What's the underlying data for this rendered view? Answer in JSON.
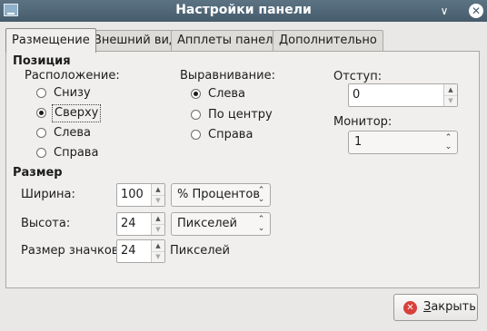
{
  "window": {
    "title": "Настройки панели",
    "app_icon": "panel-icon",
    "buttons": [
      "chevron-down-icon",
      "close-icon"
    ]
  },
  "tabs": [
    {
      "label": "Размещение",
      "active": true
    },
    {
      "label": "Внешний вид",
      "active": false
    },
    {
      "label": "Апплеты панели",
      "active": false
    },
    {
      "label": "Дополнительно",
      "active": false
    }
  ],
  "position": {
    "heading": "Позиция",
    "location": {
      "label": "Расположение:",
      "options": [
        "Снизу",
        "Сверху",
        "Слева",
        "Справа"
      ],
      "selected": "Сверху"
    },
    "alignment": {
      "label": "Выравнивание:",
      "options": [
        "Слева",
        "По центру",
        "Справа"
      ],
      "selected": "Слева"
    },
    "margin": {
      "label": "Отступ:",
      "value": "0"
    },
    "monitor": {
      "label": "Монитор:",
      "value": "1"
    }
  },
  "size": {
    "heading": "Размер",
    "width": {
      "label": "Ширина:",
      "value": "100",
      "unit": "% Процентов"
    },
    "height": {
      "label": "Высота:",
      "value": "24",
      "unit": "Пикселей"
    },
    "icon_size": {
      "label": "Размер значков:",
      "value": "24",
      "unit": "Пикселей"
    }
  },
  "footer": {
    "close_label_accel": "З",
    "close_label_rest": "акрыть",
    "close_icon": "close-circle-icon"
  },
  "colors": {
    "titlebar": "#4f6677",
    "close_icon": "#d8403b"
  }
}
